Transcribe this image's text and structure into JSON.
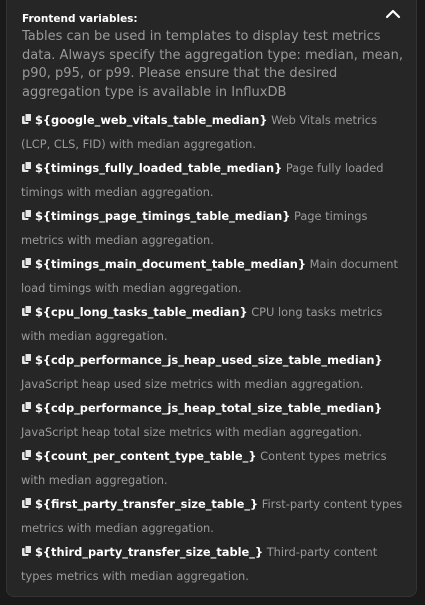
{
  "section": {
    "title": "Frontend variables:",
    "toggle_icon": "chevron-up-icon",
    "description": "Tables can be used in templates to display test metrics data. Always specify the aggregation type: median, mean, p90, p95, or p99. Please ensure that the desired aggregation type is available in InfluxDB"
  },
  "variables": [
    {
      "name": "${google_web_vitals_table_median}",
      "desc": "Web Vitals metrics (LCP, CLS, FID) with median aggregation."
    },
    {
      "name": "${timings_fully_loaded_table_median}",
      "desc": "Page fully loaded timings with median aggregation."
    },
    {
      "name": "${timings_page_timings_table_median}",
      "desc": "Page timings metrics with median aggregation."
    },
    {
      "name": "${timings_main_document_table_median}",
      "desc": "Main document load timings with median aggregation."
    },
    {
      "name": "${cpu_long_tasks_table_median}",
      "desc": "CPU long tasks metrics with median aggregation."
    },
    {
      "name": "${cdp_performance_js_heap_used_size_table_median}",
      "desc": "JavaScript heap used size metrics with median aggregation."
    },
    {
      "name": "${cdp_performance_js_heap_total_size_table_median}",
      "desc": "JavaScript heap total size metrics with median aggregation."
    },
    {
      "name": "${count_per_content_type_table_}",
      "desc": "Content types metrics with median aggregation."
    },
    {
      "name": "${first_party_transfer_size_table_}",
      "desc": "First-party content types metrics with median aggregation."
    },
    {
      "name": "${third_party_transfer_size_table_}",
      "desc": "Third-party content types metrics with median aggregation."
    }
  ],
  "copy_icon": "copy-icon"
}
